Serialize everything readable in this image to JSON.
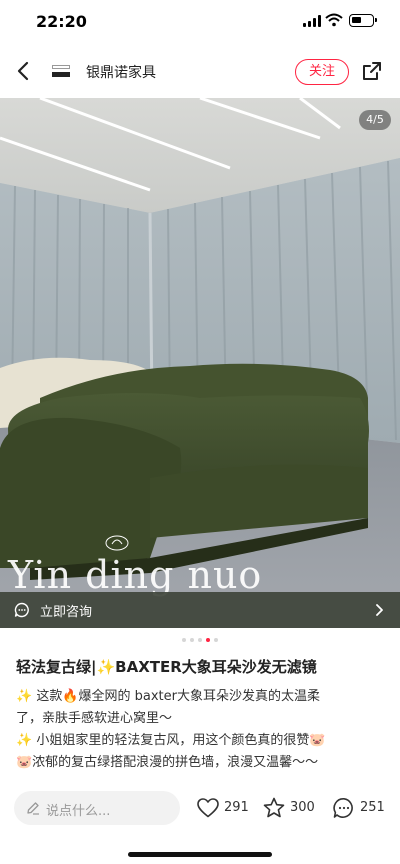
{
  "status_bar": {
    "time": "22:20"
  },
  "header": {
    "shop_name": "银鼎诺家具",
    "follow_label": "关注"
  },
  "photo": {
    "counter": "4/5",
    "watermark": "Yin ding nuo",
    "consult_label": "立即咨询",
    "total_images": 5,
    "current_image": 4
  },
  "post": {
    "title": "轻法复古绿|✨BAXTER大象耳朵沙发无滤镜",
    "lines": [
      "✨ 这款🔥爆全网的 baxter大象耳朵沙发真的太温柔",
      "了，亲肤手感软进心窝里～",
      "✨ 小姐姐家里的轻法复古风，用这个颜色真的很赞🐷",
      "🐷浓郁的复古绿搭配浪漫的拼色墙，浪漫又温馨～～"
    ]
  },
  "bottom_bar": {
    "comment_placeholder": "说点什么...",
    "likes": "291",
    "favorites": "300",
    "comments": "251"
  },
  "colors": {
    "accent": "#ff2442",
    "sofa_green": "#3f4d2d",
    "curtain": "#aab5bb"
  },
  "icons": [
    "back-arrow-icon",
    "share-icon",
    "chat-bubble-icon",
    "chevron-right-icon",
    "pen-icon",
    "heart-icon",
    "star-icon",
    "comment-icon"
  ]
}
